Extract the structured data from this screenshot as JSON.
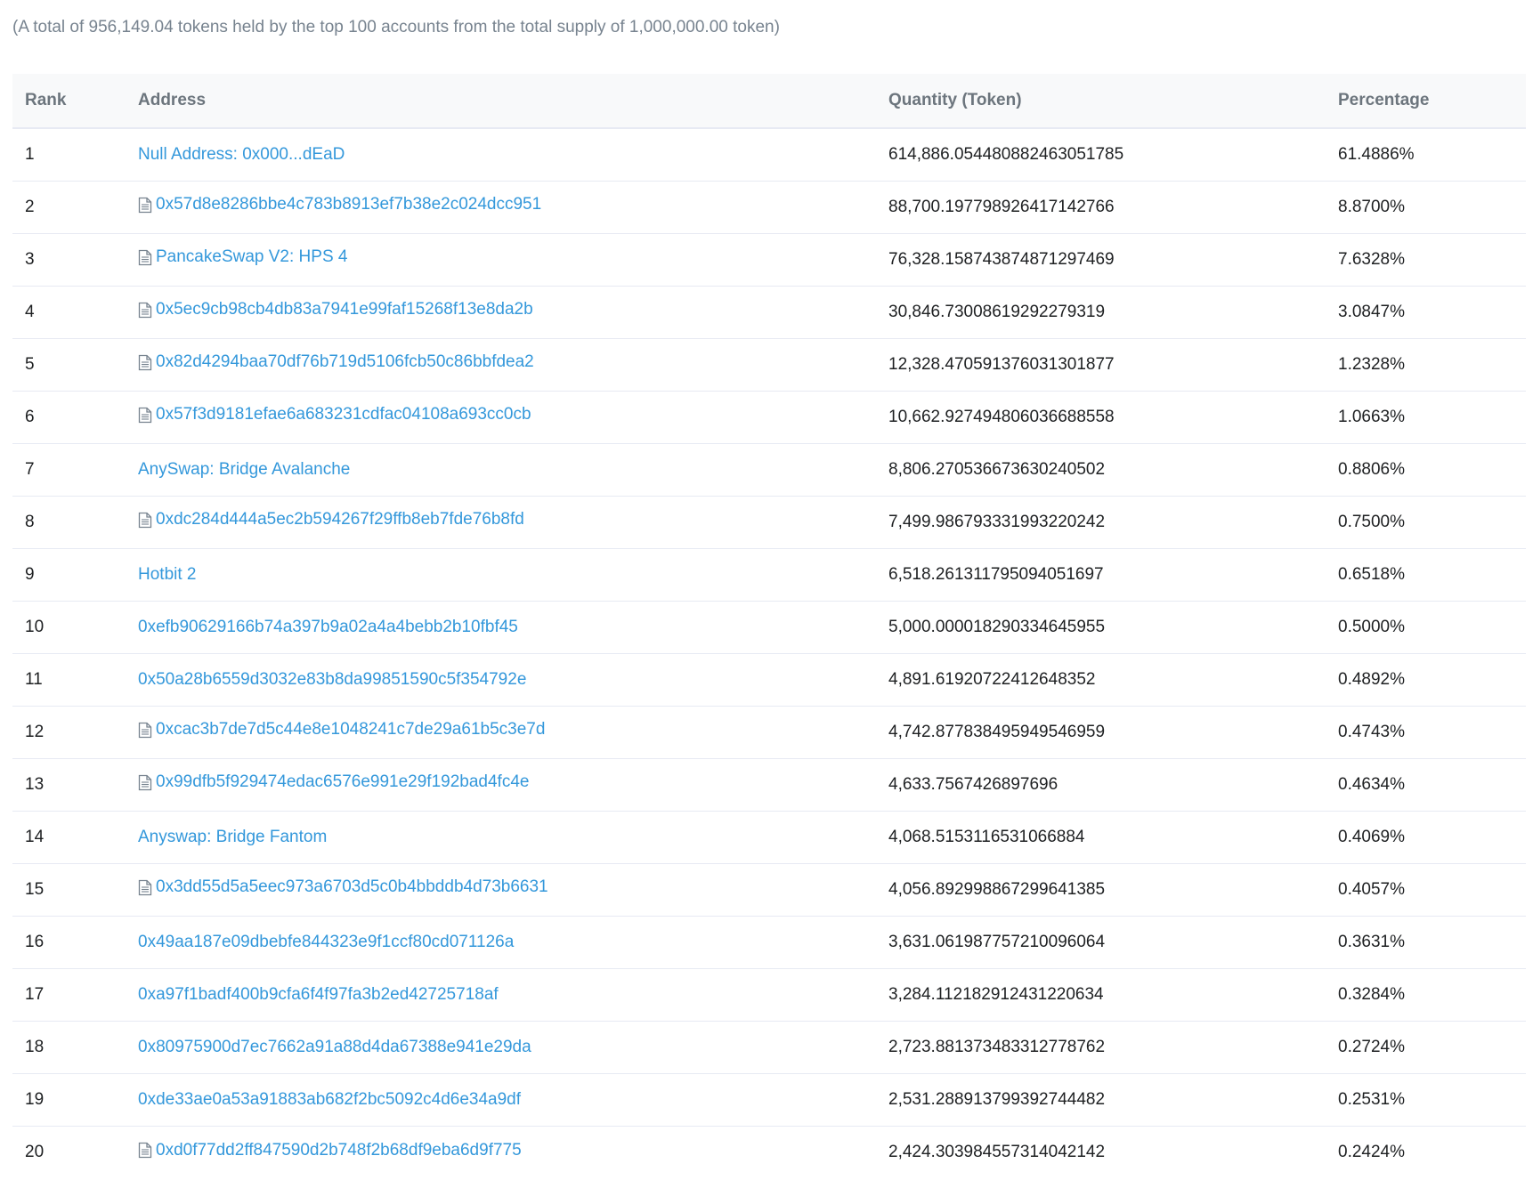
{
  "summary": "(A total of 956,149.04 tokens held by the top 100 accounts from the total supply of 1,000,000.00 token)",
  "table": {
    "headers": {
      "rank": "Rank",
      "address": "Address",
      "quantity": "Quantity (Token)",
      "percentage": "Percentage"
    },
    "rows": [
      {
        "rank": "1",
        "address": "Null Address: 0x000...dEaD",
        "contract": false,
        "quantity": "614,886.054480882463051785",
        "percentage": "61.4886%"
      },
      {
        "rank": "2",
        "address": "0x57d8e8286bbe4c783b8913ef7b38e2c024dcc951",
        "contract": true,
        "quantity": "88,700.197798926417142766",
        "percentage": "8.8700%"
      },
      {
        "rank": "3",
        "address": "PancakeSwap V2: HPS 4",
        "contract": true,
        "quantity": "76,328.158743874871297469",
        "percentage": "7.6328%"
      },
      {
        "rank": "4",
        "address": "0x5ec9cb98cb4db83a7941e99faf15268f13e8da2b",
        "contract": true,
        "quantity": "30,846.73008619292279319",
        "percentage": "3.0847%"
      },
      {
        "rank": "5",
        "address": "0x82d4294baa70df76b719d5106fcb50c86bbfdea2",
        "contract": true,
        "quantity": "12,328.470591376031301877",
        "percentage": "1.2328%"
      },
      {
        "rank": "6",
        "address": "0x57f3d9181efae6a683231cdfac04108a693cc0cb",
        "contract": true,
        "quantity": "10,662.927494806036688558",
        "percentage": "1.0663%"
      },
      {
        "rank": "7",
        "address": "AnySwap: Bridge Avalanche",
        "contract": false,
        "quantity": "8,806.270536673630240502",
        "percentage": "0.8806%"
      },
      {
        "rank": "8",
        "address": "0xdc284d444a5ec2b594267f29ffb8eb7fde76b8fd",
        "contract": true,
        "quantity": "7,499.986793331993220242",
        "percentage": "0.7500%"
      },
      {
        "rank": "9",
        "address": "Hotbit 2",
        "contract": false,
        "quantity": "6,518.261311795094051697",
        "percentage": "0.6518%"
      },
      {
        "rank": "10",
        "address": "0xefb90629166b74a397b9a02a4a4bebb2b10fbf45",
        "contract": false,
        "quantity": "5,000.000018290334645955",
        "percentage": "0.5000%"
      },
      {
        "rank": "11",
        "address": "0x50a28b6559d3032e83b8da99851590c5f354792e",
        "contract": false,
        "quantity": "4,891.61920722412648352",
        "percentage": "0.4892%"
      },
      {
        "rank": "12",
        "address": "0xcac3b7de7d5c44e8e1048241c7de29a61b5c3e7d",
        "contract": true,
        "quantity": "4,742.877838495949546959",
        "percentage": "0.4743%"
      },
      {
        "rank": "13",
        "address": "0x99dfb5f929474edac6576e991e29f192bad4fc4e",
        "contract": true,
        "quantity": "4,633.7567426897696",
        "percentage": "0.4634%"
      },
      {
        "rank": "14",
        "address": "Anyswap: Bridge Fantom",
        "contract": false,
        "quantity": "4,068.5153116531066884",
        "percentage": "0.4069%"
      },
      {
        "rank": "15",
        "address": "0x3dd55d5a5eec973a6703d5c0b4bbddb4d73b6631",
        "contract": true,
        "quantity": "4,056.892998867299641385",
        "percentage": "0.4057%"
      },
      {
        "rank": "16",
        "address": "0x49aa187e09dbebfe844323e9f1ccf80cd071126a",
        "contract": false,
        "quantity": "3,631.061987757210096064",
        "percentage": "0.3631%"
      },
      {
        "rank": "17",
        "address": "0xa97f1badf400b9cfa6f4f97fa3b2ed42725718af",
        "contract": false,
        "quantity": "3,284.112182912431220634",
        "percentage": "0.3284%"
      },
      {
        "rank": "18",
        "address": "0x80975900d7ec7662a91a88d4da67388e941e29da",
        "contract": false,
        "quantity": "2,723.881373483312778762",
        "percentage": "0.2724%"
      },
      {
        "rank": "19",
        "address": "0xde33ae0a53a91883ab682f2bc5092c4d6e34a9df",
        "contract": false,
        "quantity": "2,531.288913799392744482",
        "percentage": "0.2531%"
      },
      {
        "rank": "20",
        "address": "0xd0f77dd2ff847590d2b748f2b68df9eba6d9f775",
        "contract": true,
        "quantity": "2,424.303984557314042142",
        "percentage": "0.2424%"
      }
    ]
  },
  "colors": {
    "link": "#3498db",
    "header_bg": "#f8f9fa",
    "border": "#e7eaf3",
    "muted_text": "#77838f"
  },
  "icons": {
    "contract": "contract-file-icon"
  }
}
